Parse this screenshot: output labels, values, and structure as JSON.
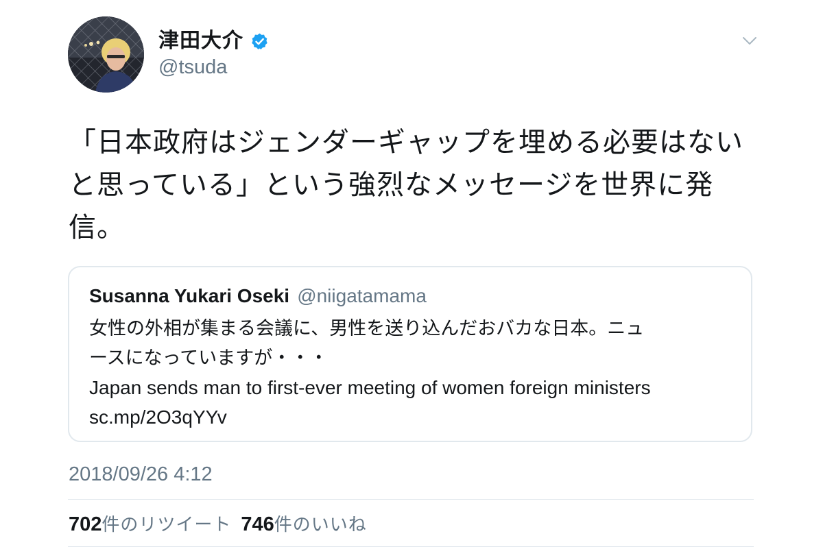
{
  "author": {
    "display_name": "津田大介",
    "handle": "@tsuda",
    "verified": true
  },
  "tweet": {
    "text_lines": [
      "「日本政府はジェンダーギャップを埋める必要はない",
      "と思っている」という強烈なメッセージを世界に発",
      "信。"
    ],
    "timestamp": "2018/09/26 4:12"
  },
  "quoted_tweet": {
    "name": "Susanna Yukari Oseki",
    "handle": "@niigatamama",
    "text_lines": [
      "女性の外相が集まる会議に、男性を送り込んだおバカな日本。ニュ",
      "ースになっていますが・・・",
      "Japan sends man to first-ever meeting of women foreign ministers",
      "sc.mp/2O3qYYv"
    ]
  },
  "stats": {
    "retweets_count": "702",
    "retweets_label": "件のリツイート",
    "likes_count": "746",
    "likes_label": "件のいいね"
  },
  "icons": {
    "verified": "verified-badge-icon",
    "caret": "chevron-down-icon"
  },
  "colors": {
    "text": "#14171a",
    "secondary": "#657786",
    "verified": "#1da1f2",
    "border": "#e1e8ed"
  }
}
